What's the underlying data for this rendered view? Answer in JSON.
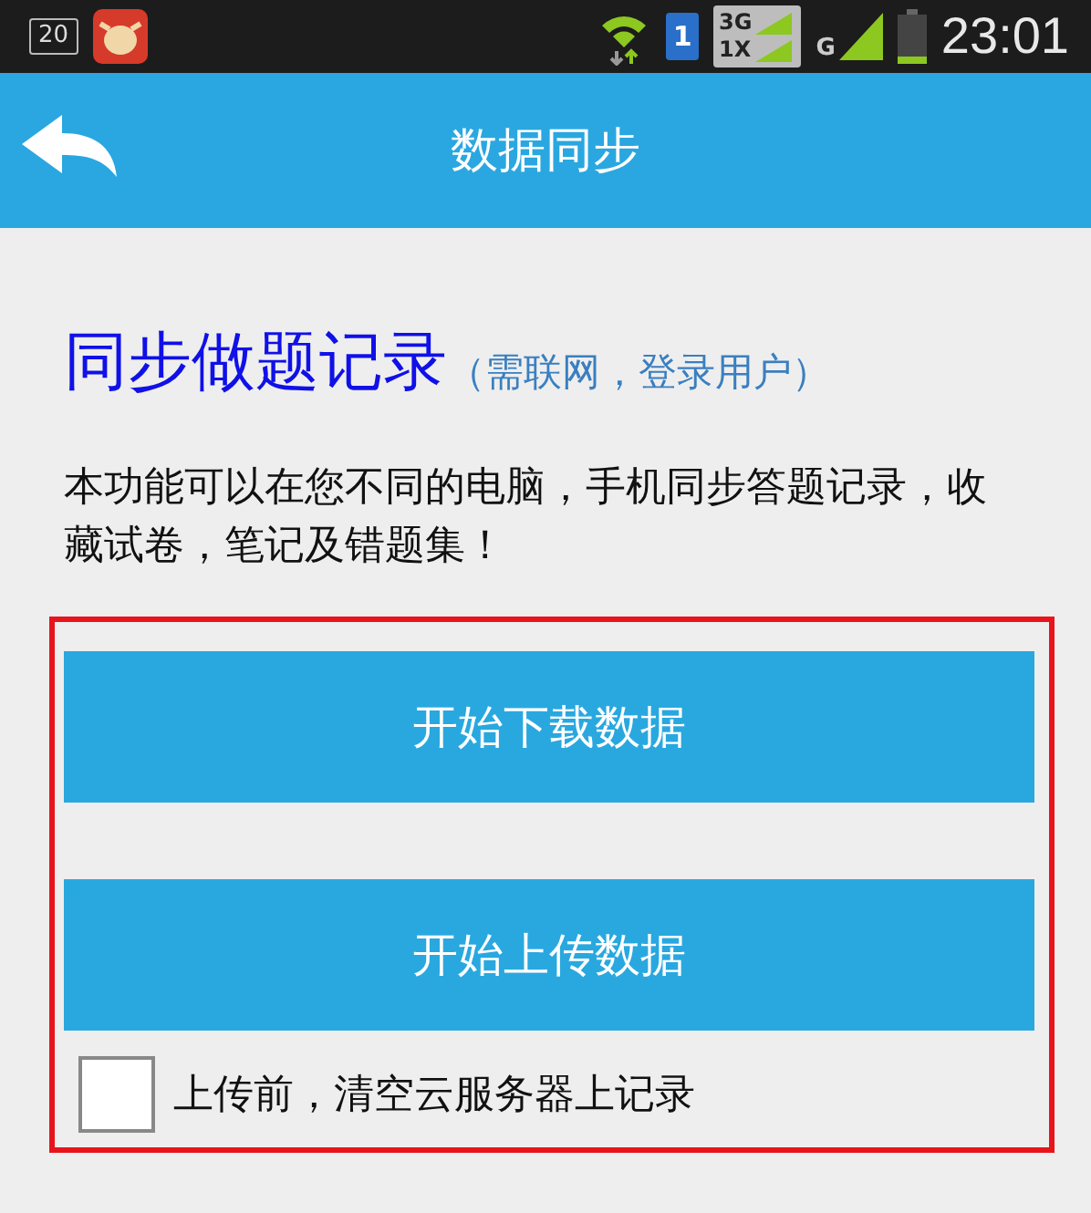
{
  "status_bar": {
    "notification_count": "20",
    "sim_slot": "1",
    "network_top": "3G",
    "network_bottom": "1X",
    "network_type": "G",
    "time": "23:01"
  },
  "header": {
    "title": "数据同步"
  },
  "sync": {
    "title": "同步做题记录",
    "subtitle": "（需联网，登录用户）",
    "description": "本功能可以在您不同的电脑，手机同步答题记录，收藏试卷，笔记及错题集！"
  },
  "buttons": [
    {
      "label": "开始下载数据"
    },
    {
      "label": "开始上传数据"
    }
  ],
  "option": {
    "label": "上传前，清空云服务器上记录",
    "checked": false
  }
}
